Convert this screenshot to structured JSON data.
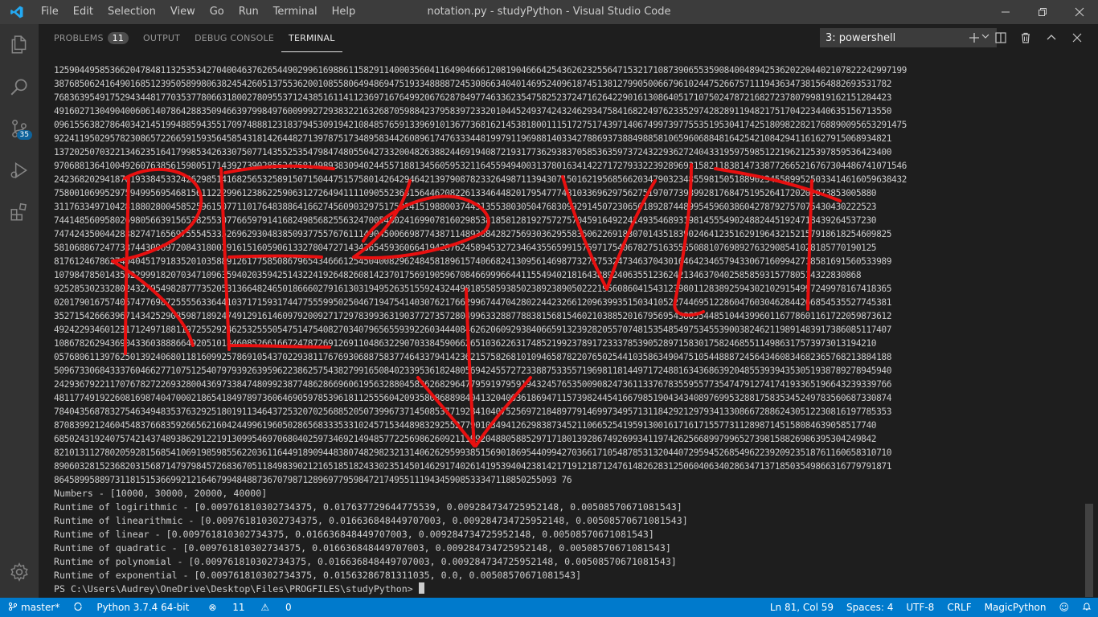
{
  "titlebar": {
    "menu": [
      "File",
      "Edit",
      "Selection",
      "View",
      "Go",
      "Run",
      "Terminal",
      "Help"
    ],
    "title": "notation.py - studyPython - Visual Studio Code"
  },
  "activity": {
    "scm_badge": "35"
  },
  "panel": {
    "tabs": {
      "problems": "PROBLEMS",
      "problems_count": "11",
      "output": "OUTPUT",
      "debug": "DEBUG CONSOLE",
      "terminal": "TERMINAL"
    },
    "terminal_select": "3: powershell"
  },
  "terminal": {
    "digit_lines": [
      "125904495853662047848113253534270400463762654490299616988611582911400035604116490466612081904666425436262325564715321710873906553590840048942536202204402107822242997199",
      "387685062416490168512395058998063824542605137553620010855806494869475193348888724530866340401469524096187451381279905006679610244752667571119436347381564882693531782",
      "768363954917529434481770353778066318002780955371243851611411236971676499206762878497746336235475825237247162642290161308640517107502478721682723780799819162151284423",
      "491602713049040060614078642883509466397998497600999272938322163268705988423795839723320104452493742432462934758416822497623352974282891194821751704223440635156713550",
      "096155638278640342145199488594355170974888123183794530919421084857659133969101367736816214538180011151727517439714067499739775535195304174251809822821768890095653291475",
      "922411950295782308657226659159356458543181426448271397875173489583442608961747633344819979119698814033427886937388498858106596068848164254210842941161627915068934821",
      "137202507032213462351641799853426330750771435525354798474805504273320048263882446919408721931773629383705853635973724322936272404331959759851221962125397859536423400",
      "970688136410049260763856159805171439273902856247681498938309402445571881345605953211645594940031378016341422717279332239289693158211838147338772665216767304486741071546",
      "242368202941870193384533242629851416825653258915071504475157580142642946421397908782332649871139430715016219568566203479032348559815051889023455899525033414616059638432",
      "758001069952975949956954681561122299612386225906312726494111109055236815644620822613346448201795477748103369629756275197077398992817684751952641720202873853005880",
      "311763349710428188028004585259615077110176483886416627456090329751750141519880037443135538030504768309929145072306501892874489954596038604278792757075430430222523",
      "744148560958026980566391565382553077665979141682498568255632470054802416990781602985381858128192757275704591649224149354689319814555490248824451924718439264537230",
      "747424350044283827471656975554533526962930483850937755767611149045006698774387114893684282756930362955836062269183070143518390246412351629196432152157918618254609825",
      "581068867247733744309697208431800391615160590613327804727143436545936066419428762458945327234643556599157597175406782751635565088107698927632908541028185770190125",
      "817612467862740404517918352010358891261775850867965434666125450400829624845818961574066824130956146987732727532473463704301646423465794330671609942718581691560533989",
      "107984785014353229991820703471096359402035942514322419264826081423701756919059670846699966441155494021816438892406355123624213463704025858593157780514322830868",
      "925285302332802432795498287773520531366482465018666027916130319495263515592432449818558593850238923890502221956086041543123980112838925943021029154997249978167418365",
      "020179016757405747769872555563364410371715931744775559950250467194754140307621766299674470428022442326612096399351503410522744695122860476030462844266854535527745381",
      "352715426663967143425290859871892474912916146097920092717297839936319037727357280499633288778838156815460210388520167956954388554485104439960116778601161722059873612",
      "492422934601231712497188119725529246253255505475147540827034079656559392260344408462620609293840665913239282055707481535485497534553900382462119891483917386085117407",
      "108678262943690433603888664920510184608526616672478726912691104863229070338459066265103622631748521992378917233378539052897158301758246855114986317573973013194210",
      "057680611397625013924068011816099257869105437022938117676930688758377464337941423621575826810109465878220765025441035863490475105448887245643460834682365768213884188",
      "509673306843337604662771075125407979392639596223862575438279916508402339536182480569424557272338875335571969811814497172488163436863920485539394353051938789278945940",
      "242936792211707678272269328004369733847480992387748628669606195632880458362682964779591979591943245765350090824736113376783559557735474791274174193365196643239339766",
      "481177491922608169874047000218654184978973606469059785396181125556042093580868898404132040636186947115739824454166798519043434089769953288175835345249783560687330874",
      "784043568783275463494835376329251801911346437253207025688520507399673714508537719284104075256972184897791469973495713118429212979341330866728862430512230816197785353",
      "870839921246045483766835926656216042449961960502865683335331024571534489832925527790103494126298387345211066525419591300161716171557731128987145158084639058517740",
      "685024319240757421437489386291221913099546970680402597346921494857722569862609211199204880588529717180139286749269934119742625668997996527398158826986395304249842",
      "821013112780205928156854106919859855622036116449189094483807482982321314062629599385156901869544099427036617105487853132044072959452685496223920923518761160658310710",
      "890603281523682031568714797984572683670511849839021216518518243302351450146291740261419539404238142171912187124761482628312506040634028634713718503549866316779791871",
      "864589958897311815153669921216467994848873670798712896977959847217495511194345908533347118850255093 76"
    ],
    "output_lines": [
      "Numbers - [10000, 30000, 20000, 40000]",
      "Runtime of logirithmic - [0.009761810302734375, 0.017637729644775539, 0.009284734725952148, 0.00508570671081543]",
      "Runtime of linearithmic - [0.009761810302734375, 0.016636848449707003, 0.009284734725952148, 0.00508570671081543]",
      "Runtime of linear - [0.009761810302734375, 0.016636848449707003, 0.009284734725952148, 0.00508570671081543]",
      "Runtime of quadratic - [0.009761810302734375, 0.016636848449707003, 0.009284734725952148, 0.00508570671081543]",
      "Runtime of polynomial - [0.009761810302734375, 0.016636848449707003, 0.009284734725952148, 0.00508570671081543]",
      "Runtime of exponential - [0.009761810302734375, 0.01563286781311035, 0.0, 0.00508570671081543]"
    ],
    "prompt": "PS C:\\Users\\Audrey\\OneDrive\\Desktop\\Files\\PROGFILES\\studyPython>"
  },
  "statusbar": {
    "branch": "master*",
    "python": "Python 3.7.4 64-bit",
    "errors": "11",
    "warnings": "0",
    "position": "Ln 81, Col 59",
    "spaces": "Spaces: 4",
    "encoding": "UTF-8",
    "eol": "CRLF",
    "language": "MagicPython"
  },
  "colors": {
    "titlebar": "#3c3c3c",
    "activitybar": "#333333",
    "editor_bg": "#1e1e1e",
    "statusbar": "#007acc",
    "scribble": "#e81010"
  }
}
